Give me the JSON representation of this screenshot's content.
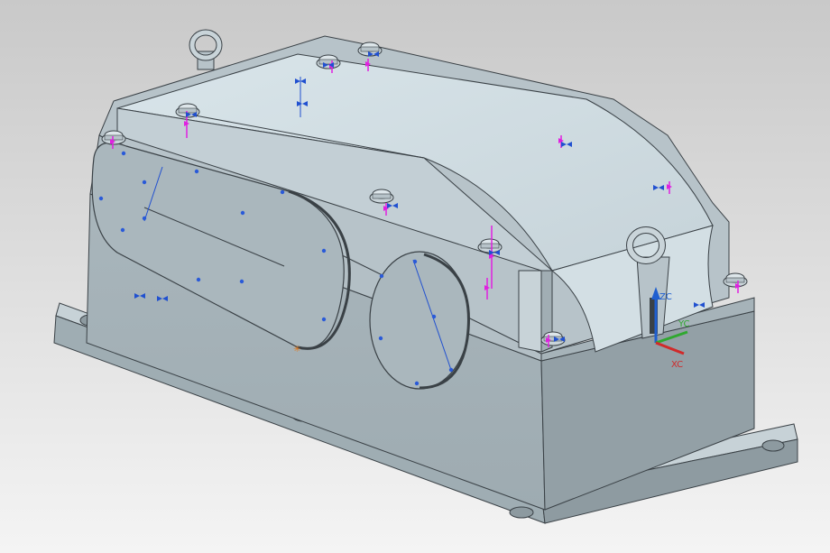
{
  "viewport": {
    "background_top": "#c9c9c9",
    "background_bottom": "#f4f4f4"
  },
  "model": {
    "body_color": "#b9c6cc",
    "body_light": "#dbe6ea",
    "body_dark": "#8d9aa0",
    "edge_color": "#3a4146"
  },
  "triad": {
    "labels": {
      "z": "ZC",
      "y": "YC",
      "x": "XC"
    },
    "colors": {
      "z": "#1f5fd0",
      "y": "#2fa82f",
      "x": "#d02a2a"
    }
  },
  "annotation_colors": {
    "constraint": "#e020e0",
    "dimension": "#2050d0",
    "point": "#2a5ad8",
    "anchor": "#e07a20"
  }
}
